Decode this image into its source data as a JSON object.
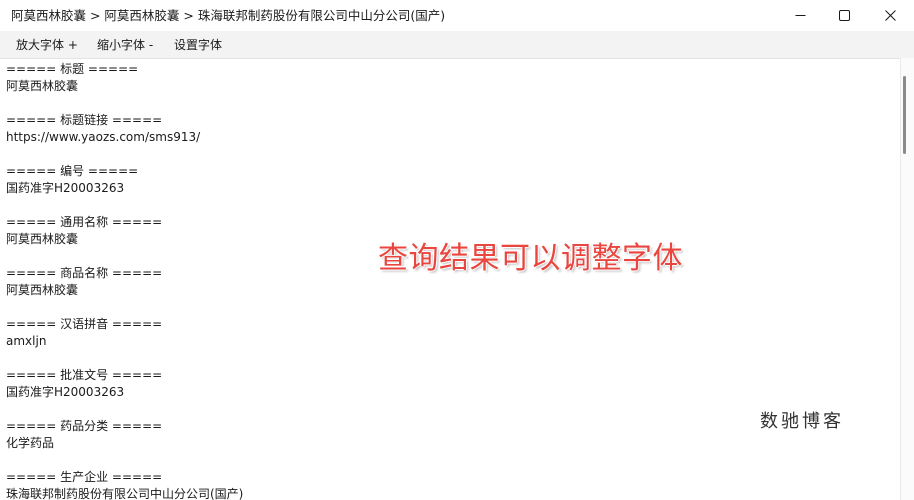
{
  "window": {
    "title": "阿莫西林胶囊 > 阿莫西林胶囊 > 珠海联邦制药股份有限公司中山分公司(国产)",
    "controls": {
      "minimize_icon": "minimize-icon",
      "maximize_icon": "maximize-icon",
      "close_icon": "close-icon"
    }
  },
  "menu": {
    "items": [
      {
        "label": "放大字体 +"
      },
      {
        "label": "缩小字体 -"
      },
      {
        "label": "设置字体"
      }
    ]
  },
  "content": {
    "lines": [
      "===== 标题 =====",
      "阿莫西林胶囊",
      "",
      "===== 标题链接 =====",
      "https://www.yaozs.com/sms913/",
      "",
      "===== 编号 =====",
      "国药准字H20003263",
      "",
      "===== 通用名称 =====",
      "阿莫西林胶囊",
      "",
      "===== 商品名称 =====",
      "阿莫西林胶囊",
      "",
      "===== 汉语拼音 =====",
      "amxljn",
      "",
      "===== 批准文号 =====",
      "国药准字H20003263",
      "",
      "===== 药品分类 =====",
      "化学药品",
      "",
      "===== 生产企业 =====",
      "珠海联邦制药股份有限公司中山分公司(国产)"
    ]
  },
  "overlay": {
    "caption": "查询结果可以调整字体",
    "caption_color": "#e8463f",
    "watermark": "数驰博客"
  }
}
